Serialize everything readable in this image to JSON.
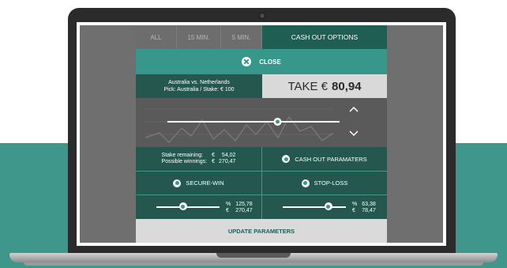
{
  "tabs": [
    {
      "label": "ALL"
    },
    {
      "label": "15 MIN."
    },
    {
      "label": "5 MIN."
    },
    {
      "label": "CASH OUT OPTIONS"
    }
  ],
  "close": {
    "label": "CLOSE"
  },
  "match": {
    "teams": "Australia vs. Netherlands",
    "pick": "Pick: Australia / Stake: € 100"
  },
  "take": {
    "label": "TAKE €",
    "amount": "80,94"
  },
  "main_slider": {
    "level": 0.64
  },
  "stats": {
    "stake_remaining_label": "Stake remaining:",
    "possible_winnings_label": "Possible winnings:",
    "stake_currency": "€",
    "stake_remaining_value": "54,02",
    "winnings_currency": "€",
    "possible_winnings_value": "270,47"
  },
  "options": {
    "cash_out_parameters": "CASH OUT PARAMATERS",
    "secure_win": "SECURE-WIN",
    "stop_loss": "STOP-LOSS"
  },
  "secure_win_slider": {
    "level": 0.42,
    "percent_unit": "%",
    "percent_value": "125,78",
    "currency_unit": "€",
    "amount_value": "270,47"
  },
  "stop_loss_slider": {
    "level": 0.72,
    "percent_unit": "%",
    "percent_value": "63,38",
    "currency_unit": "€",
    "amount_value": "78,47"
  },
  "update": {
    "label": "UPDATE PARAMETERS"
  },
  "colors": {
    "accent": "#37978a",
    "dark_teal": "#24584f",
    "screen_bg": "#6f6f6f"
  }
}
